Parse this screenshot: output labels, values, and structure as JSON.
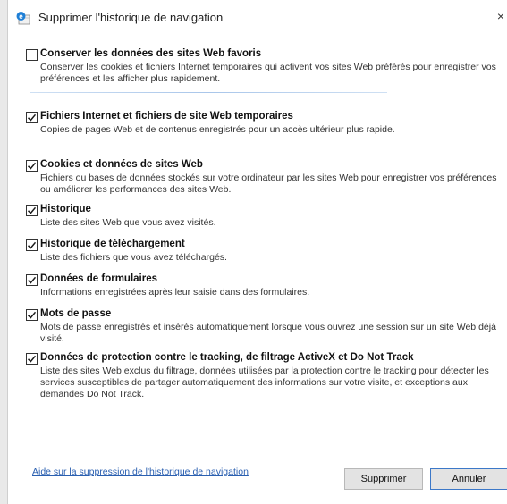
{
  "window": {
    "title": "Supprimer l'historique de navigation",
    "close_glyph": "×"
  },
  "options": [
    {
      "title": "Conserver les données des sites Web favoris",
      "description": "Conserver les cookies et fichiers Internet temporaires qui activent vos sites Web préférés pour enregistrer vos préférences et les afficher plus rapidement.",
      "checked": false
    },
    {
      "title": "Fichiers Internet et fichiers de site Web temporaires",
      "description": "Copies de pages Web et de contenus enregistrés pour un accès ultérieur plus rapide.",
      "checked": true
    },
    {
      "title": "Cookies et données de sites Web",
      "description": "Fichiers ou bases de données stockés sur votre ordinateur par les sites Web pour enregistrer vos préférences ou améliorer les performances des sites Web.",
      "checked": true
    },
    {
      "title": "Historique",
      "description": "Liste des sites Web que vous avez visités.",
      "checked": true
    },
    {
      "title": "Historique de téléchargement",
      "description": "Liste des fichiers que vous avez téléchargés.",
      "checked": true
    },
    {
      "title": "Données de formulaires",
      "description": "Informations enregistrées après leur saisie dans des formulaires.",
      "checked": true
    },
    {
      "title": "Mots de passe",
      "description": "Mots de passe enregistrés et insérés automatiquement lorsque vous ouvrez une session sur un site Web déjà visité.",
      "checked": true
    },
    {
      "title": "Données de protection contre le tracking, de filtrage ActiveX et Do Not Track",
      "description": "Liste des sites Web exclus du filtrage, données utilisées par la protection contre le tracking pour détecter les services susceptibles de partager automatiquement des informations sur votre visite, et exceptions aux demandes Do Not Track.",
      "checked": true
    }
  ],
  "footer": {
    "help_link": "Aide sur la suppression de l'historique de navigation",
    "delete_label": "Supprimer",
    "cancel_label": "Annuler"
  },
  "colors": {
    "link": "#2a5fb0",
    "accent_border": "#3c78c8"
  },
  "icons": {
    "app": "internet-explorer-icon",
    "check": "checkmark-icon"
  }
}
